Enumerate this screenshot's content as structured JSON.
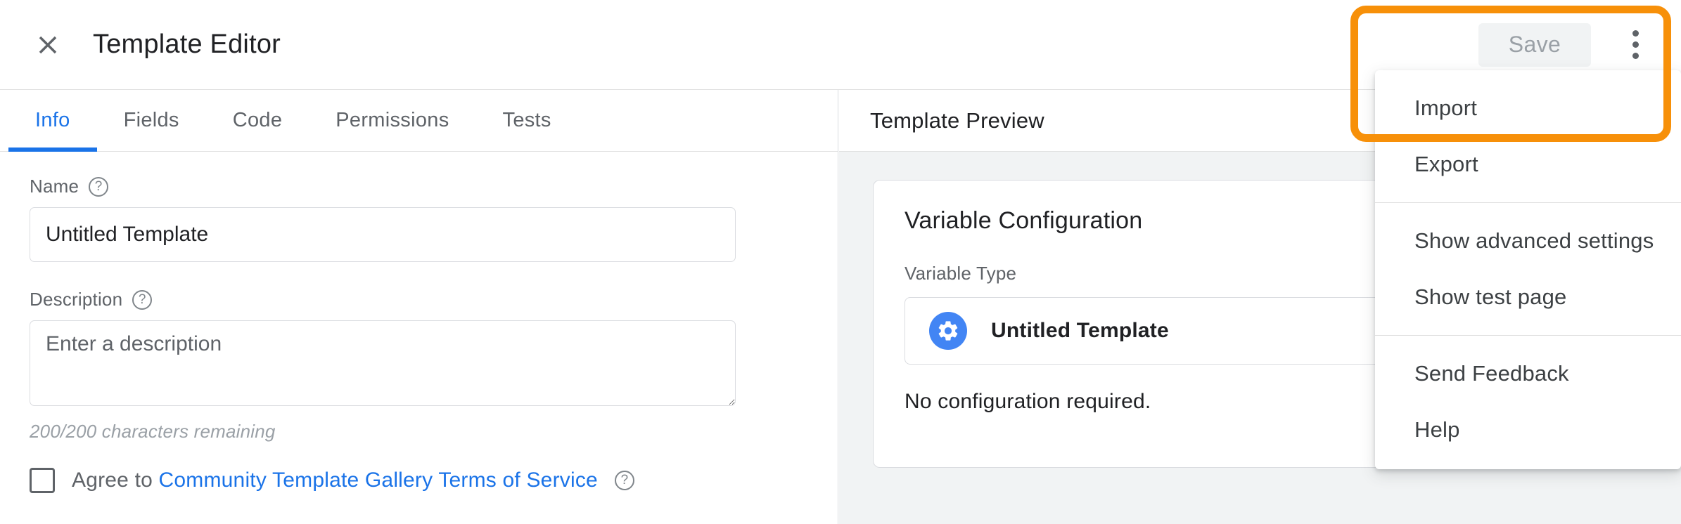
{
  "topbar": {
    "close_icon": "close-icon",
    "title": "Template Editor",
    "save_label": "Save",
    "kebab_icon": "more-vert-icon"
  },
  "tabs": [
    {
      "label": "Info",
      "active": true
    },
    {
      "label": "Fields",
      "active": false
    },
    {
      "label": "Code",
      "active": false
    },
    {
      "label": "Permissions",
      "active": false
    },
    {
      "label": "Tests",
      "active": false
    }
  ],
  "form": {
    "name_label": "Name",
    "name_value": "Untitled Template",
    "name_placeholder": "Untitled Template",
    "description_label": "Description",
    "description_value": "",
    "description_placeholder": "Enter a description",
    "char_count": "200/200 characters remaining",
    "agree_prefix": "Agree to ",
    "agree_link": "Community Template Gallery Terms of Service",
    "help_glyph": "?"
  },
  "preview": {
    "title": "Template Preview",
    "card_title": "Variable Configuration",
    "variable_type_label": "Variable Type",
    "variable_type_name": "Untitled Template",
    "variable_type_icon": "gear-icon",
    "no_config_text": "No configuration required."
  },
  "menu": {
    "items": [
      {
        "label": "Import",
        "sep_after": false
      },
      {
        "label": "Export",
        "sep_after": true
      },
      {
        "label": "Show advanced settings",
        "sep_after": false
      },
      {
        "label": "Show test page",
        "sep_after": true
      },
      {
        "label": "Send Feedback",
        "sep_after": false
      },
      {
        "label": "Help",
        "sep_after": false
      }
    ]
  },
  "annotation": {
    "highlight_color": "#f79009"
  },
  "colors": {
    "accent_blue": "#1a73e8",
    "icon_blue": "#4285f4",
    "text_primary": "#202124",
    "text_secondary": "#5f6368",
    "panel_bg": "#f1f3f4",
    "border": "#dadce0"
  }
}
